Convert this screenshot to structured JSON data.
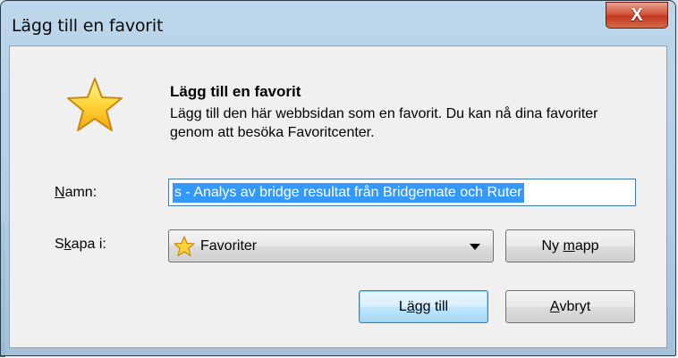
{
  "window": {
    "title": "Lägg till en favorit",
    "close_glyph": "X"
  },
  "header": {
    "heading": "Lägg till en favorit",
    "description": "Lägg till den här webbsidan som en favorit. Du kan nå dina favoriter genom att besöka Favoritcenter."
  },
  "form": {
    "name_label_prefix": "",
    "name_label_accel": "N",
    "name_label_rest": "amn:",
    "name_value": "s - Analys av bridge resultat från Bridgemate och Ruter",
    "create_label_prefix": "S",
    "create_label_accel": "k",
    "create_label_rest": "apa i:",
    "create_in_value": "Favoriter"
  },
  "buttons": {
    "new_folder_prefix": "Ny ",
    "new_folder_accel": "m",
    "new_folder_rest": "app",
    "add_prefix": "L",
    "add_accel": "ä",
    "add_rest": "gg till",
    "cancel_prefix": "",
    "cancel_accel": "A",
    "cancel_rest": "vbryt"
  },
  "colors": {
    "selection": "#3399ff",
    "close_button": "#c0361f",
    "accent": "#3c7fb1"
  },
  "icons": {
    "favorite": "star-icon",
    "dropdown": "chevron-down-icon",
    "close": "close-icon"
  }
}
